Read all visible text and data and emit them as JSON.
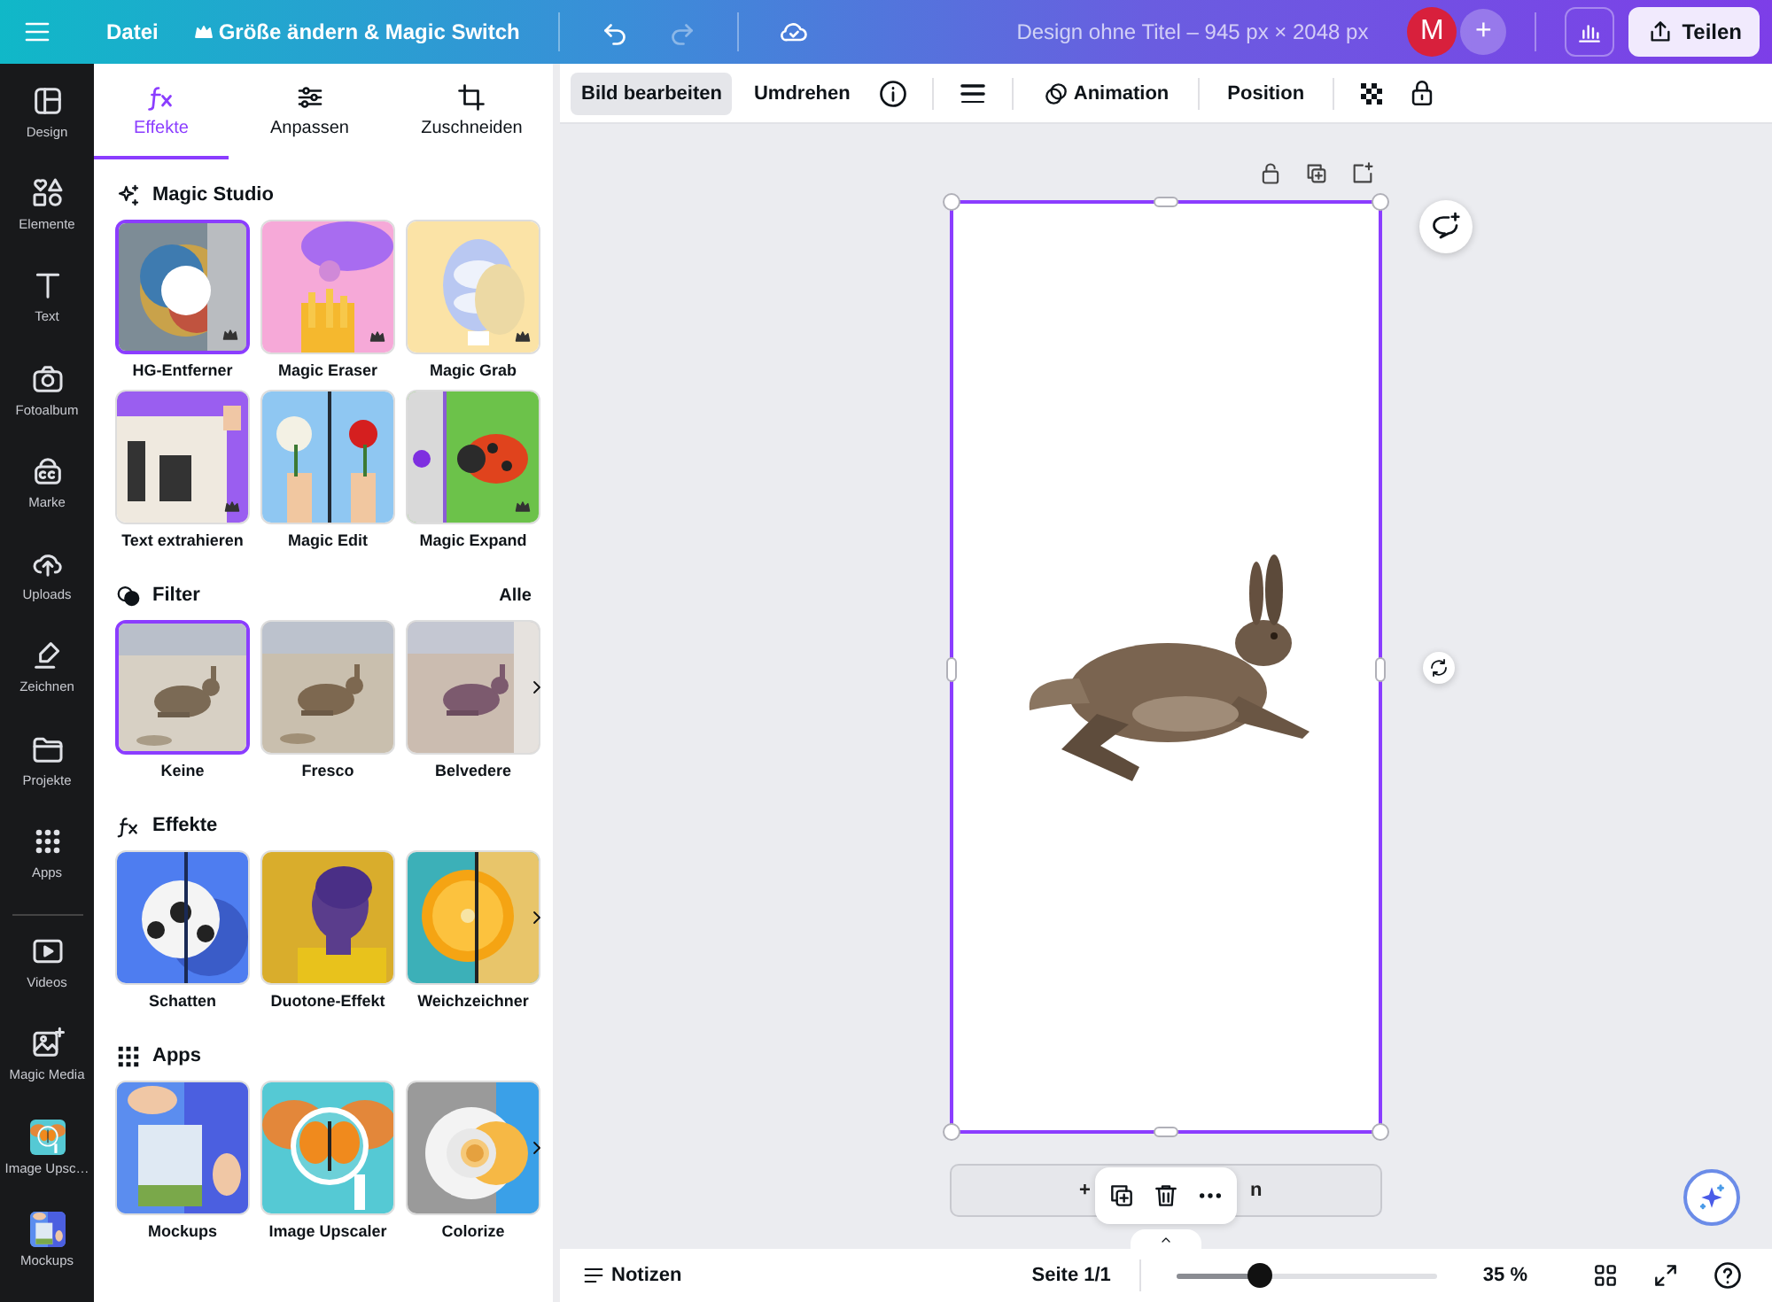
{
  "topbar": {
    "menu": "Datei",
    "resize": "Größe ändern & Magic Switch",
    "redo_disabled": true,
    "title": "Design ohne Titel – 945 px × 2048 px",
    "avatar": "M",
    "collab_button": "+",
    "share": "Teilen"
  },
  "rail": [
    {
      "label": "Design",
      "kind": "icon"
    },
    {
      "label": "Elemente",
      "kind": "icon"
    },
    {
      "label": "Text",
      "kind": "icon"
    },
    {
      "label": "Fotoalbum",
      "kind": "icon"
    },
    {
      "label": "Marke",
      "kind": "icon"
    },
    {
      "label": "Uploads",
      "kind": "icon"
    },
    {
      "label": "Zeichnen",
      "kind": "icon"
    },
    {
      "label": "Projekte",
      "kind": "icon"
    },
    {
      "label": "Apps",
      "kind": "icon"
    },
    {
      "kind": "divider"
    },
    {
      "label": "Videos",
      "kind": "icon"
    },
    {
      "label": "Magic Media",
      "kind": "icon"
    },
    {
      "label": "Image Upsc…",
      "kind": "thumb"
    },
    {
      "label": "Mockups",
      "kind": "thumb"
    }
  ],
  "panel": {
    "tabs": [
      {
        "label": "Effekte",
        "selected": true
      },
      {
        "label": "Anpassen",
        "selected": false
      },
      {
        "label": "Zuschneiden",
        "selected": false
      }
    ],
    "sections": [
      {
        "title": "Magic Studio",
        "more": false,
        "tiles": [
          {
            "label": "HG-Entferner",
            "selected": true,
            "premium": true
          },
          {
            "label": "Magic Eraser",
            "selected": false,
            "premium": true
          },
          {
            "label": "Magic Grab",
            "selected": false,
            "premium": true
          },
          {
            "label": "Text extrahieren",
            "selected": false,
            "premium": true
          },
          {
            "label": "Magic Edit",
            "selected": false,
            "premium": false
          },
          {
            "label": "Magic Expand",
            "selected": false,
            "premium": true
          }
        ]
      },
      {
        "title": "Filter",
        "action": "Alle",
        "more": true,
        "tiles": [
          {
            "label": "Keine",
            "selected": true,
            "premium": false
          },
          {
            "label": "Fresco",
            "selected": false,
            "premium": false
          },
          {
            "label": "Belvedere",
            "selected": false,
            "premium": false
          }
        ]
      },
      {
        "title": "Effekte",
        "more": true,
        "tiles": [
          {
            "label": "Schatten",
            "selected": false,
            "premium": false
          },
          {
            "label": "Duotone-Effekt",
            "selected": false,
            "premium": false
          },
          {
            "label": "Weichzeichner",
            "selected": false,
            "premium": false
          }
        ]
      },
      {
        "title": "Apps",
        "more": true,
        "tiles": [
          {
            "label": "Mockups",
            "selected": false,
            "premium": false
          },
          {
            "label": "Image Upscaler",
            "selected": false,
            "premium": false
          },
          {
            "label": "Colorize",
            "selected": false,
            "premium": false
          }
        ]
      }
    ]
  },
  "toolbar": [
    {
      "kind": "text",
      "label": "Bild bearbeiten",
      "selected": true
    },
    {
      "kind": "text",
      "label": "Umdrehen",
      "selected": false
    },
    {
      "kind": "info"
    },
    {
      "kind": "divider"
    },
    {
      "kind": "lines"
    },
    {
      "kind": "divider"
    },
    {
      "kind": "animation",
      "label": "Animation"
    },
    {
      "kind": "divider"
    },
    {
      "kind": "text",
      "label": "Position",
      "selected": false
    },
    {
      "kind": "divider"
    },
    {
      "kind": "checker"
    },
    {
      "kind": "lock"
    }
  ],
  "canvas": {
    "add_page_left": "+",
    "add_page_right": "n"
  },
  "bottombar": {
    "notes": "Notizen",
    "page": "Seite 1/1",
    "zoom": {
      "level": 0.32
    },
    "zoom_reading": "35 %"
  }
}
